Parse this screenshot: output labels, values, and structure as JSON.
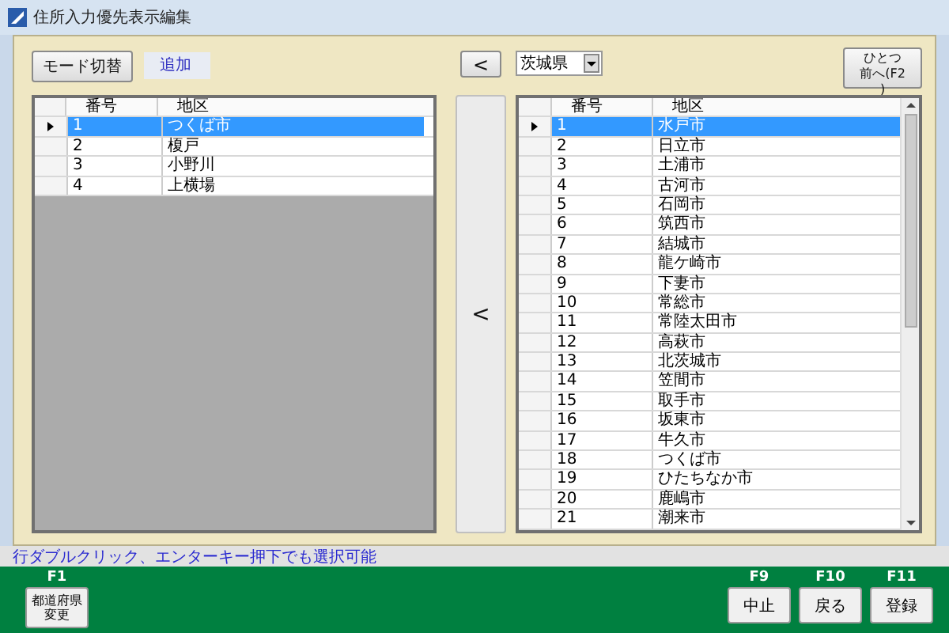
{
  "window": {
    "title": "住所入力優先表示編集"
  },
  "toolbar": {
    "mode_button": "モード切替",
    "mode_label": "追加",
    "back_button": "<",
    "prefecture": "茨城県",
    "prev_button": "ひとつ前へ(F2)"
  },
  "left_grid": {
    "columns": [
      "番号",
      "地区"
    ],
    "rows": [
      {
        "no": "1",
        "area": "つくば市",
        "selected": true
      },
      {
        "no": "2",
        "area": "榎戸",
        "selected": false
      },
      {
        "no": "3",
        "area": "小野川",
        "selected": false
      },
      {
        "no": "4",
        "area": "上横場",
        "selected": false
      }
    ]
  },
  "move_button": "<",
  "right_grid": {
    "columns": [
      "番号",
      "地区"
    ],
    "rows": [
      {
        "no": "1",
        "area": "水戸市",
        "selected": true
      },
      {
        "no": "2",
        "area": "日立市",
        "selected": false
      },
      {
        "no": "3",
        "area": "土浦市",
        "selected": false
      },
      {
        "no": "4",
        "area": "古河市",
        "selected": false
      },
      {
        "no": "5",
        "area": "石岡市",
        "selected": false
      },
      {
        "no": "6",
        "area": "筑西市",
        "selected": false
      },
      {
        "no": "7",
        "area": "結城市",
        "selected": false
      },
      {
        "no": "8",
        "area": "龍ケ崎市",
        "selected": false
      },
      {
        "no": "9",
        "area": "下妻市",
        "selected": false
      },
      {
        "no": "10",
        "area": "常総市",
        "selected": false
      },
      {
        "no": "11",
        "area": "常陸太田市",
        "selected": false
      },
      {
        "no": "12",
        "area": "高萩市",
        "selected": false
      },
      {
        "no": "13",
        "area": "北茨城市",
        "selected": false
      },
      {
        "no": "14",
        "area": "笠間市",
        "selected": false
      },
      {
        "no": "15",
        "area": "取手市",
        "selected": false
      },
      {
        "no": "16",
        "area": "坂東市",
        "selected": false
      },
      {
        "no": "17",
        "area": "牛久市",
        "selected": false
      },
      {
        "no": "18",
        "area": "つくば市",
        "selected": false
      },
      {
        "no": "19",
        "area": "ひたちなか市",
        "selected": false
      },
      {
        "no": "20",
        "area": "鹿嶋市",
        "selected": false
      },
      {
        "no": "21",
        "area": "潮来市",
        "selected": false
      }
    ]
  },
  "status_bar": "行ダブルクリック、エンターキー押下でも選択可能",
  "footer": {
    "left_buttons": [
      {
        "key": "F1",
        "label": "都道府県変更"
      }
    ],
    "right_buttons": [
      {
        "key": "F9",
        "label": "中止"
      },
      {
        "key": "F10",
        "label": "戻る"
      },
      {
        "key": "F11",
        "label": "登録"
      }
    ]
  }
}
